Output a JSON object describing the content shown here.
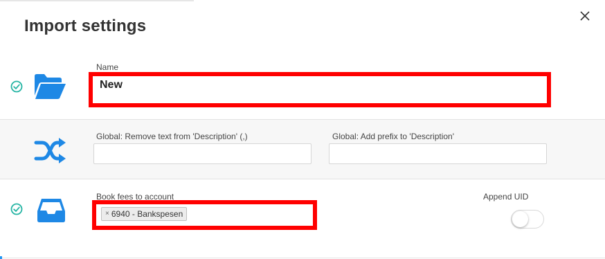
{
  "dialog": {
    "title": "Import settings"
  },
  "icons": {
    "close": "close-icon",
    "folder": "folder-open-icon",
    "shuffle": "shuffle-icon",
    "inbox": "inbox-icon",
    "check": "check-circle-icon"
  },
  "colors": {
    "accent_blue": "#1e88e5",
    "check_teal": "#26b5a4",
    "highlight_red": "#ff0000"
  },
  "name_section": {
    "label": "Name",
    "value": "New"
  },
  "global_section": {
    "remove_text_label": "Global: Remove text from 'Description' (,)",
    "remove_text_value": "",
    "add_prefix_label": "Global: Add prefix to 'Description'",
    "add_prefix_value": ""
  },
  "fees_section": {
    "book_fees_label": "Book fees to account",
    "selected_tag": "6940 - Bankspesen",
    "tag_remove_symbol": "×",
    "append_uid_label": "Append UID",
    "append_uid_on": false
  }
}
